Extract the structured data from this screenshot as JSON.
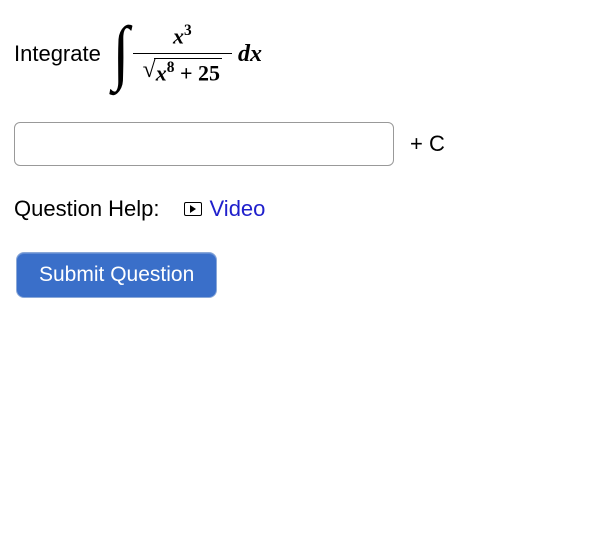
{
  "question": {
    "instruction": "Integrate",
    "integral": {
      "numerator_var": "x",
      "numerator_exp": "3",
      "denom_var": "x",
      "denom_exp": "8",
      "denom_constant": " + 25",
      "differential": "dx"
    }
  },
  "answer": {
    "input_value": "",
    "suffix": "+ C"
  },
  "help": {
    "label": "Question Help:",
    "video_link": "Video"
  },
  "submit": {
    "label": "Submit Question"
  }
}
